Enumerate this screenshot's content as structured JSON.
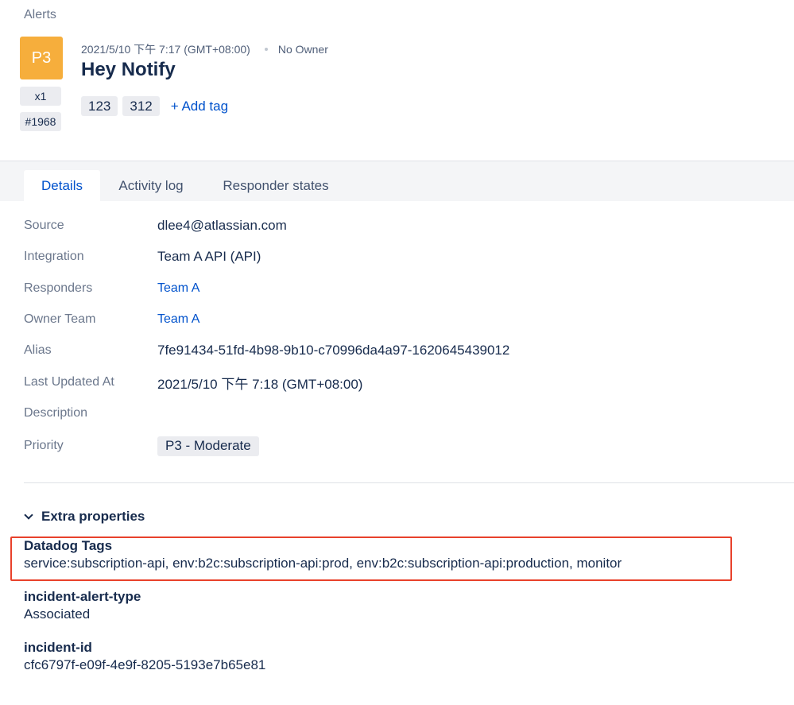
{
  "breadcrumb": "Alerts",
  "alert": {
    "priority": "P3",
    "count": "x1",
    "number": "#1968",
    "timestamp": "2021/5/10 下午 7:17 (GMT+08:00)",
    "owner": "No Owner",
    "title": "Hey Notify",
    "tags": [
      "123",
      "312"
    ],
    "add_tag_label": "+ Add tag",
    "priority_color": "#f6ae3c"
  },
  "tabs": [
    {
      "label": "Details",
      "active": true
    },
    {
      "label": "Activity log",
      "active": false
    },
    {
      "label": "Responder states",
      "active": false
    }
  ],
  "details": {
    "source": {
      "label": "Source",
      "value": "dlee4@atlassian.com"
    },
    "integration": {
      "label": "Integration",
      "value": "Team A API (API)"
    },
    "responders": {
      "label": "Responders",
      "value": "Team A"
    },
    "owner_team": {
      "label": "Owner Team",
      "value": "Team A"
    },
    "alias": {
      "label": "Alias",
      "value": "7fe91434-51fd-4b98-9b10-c70996da4a97-1620645439012"
    },
    "last_updated": {
      "label": "Last Updated At",
      "value": "2021/5/10 下午 7:18 (GMT+08:00)"
    },
    "description": {
      "label": "Description",
      "value": ""
    },
    "priority": {
      "label": "Priority",
      "value": "P3 - Moderate"
    }
  },
  "extra_properties": {
    "header": "Extra properties",
    "items": [
      {
        "name": "Datadog Tags",
        "value": "service:subscription-api, env:b2c:subscription-api:prod, env:b2c:subscription-api:production, monitor"
      },
      {
        "name": "incident-alert-type",
        "value": "Associated"
      },
      {
        "name": "incident-id",
        "value": "cfc6797f-e09f-4e9f-8205-5193e7b65e81"
      }
    ]
  },
  "colors": {
    "accent": "#0052cc",
    "highlight_border": "#e8412b"
  }
}
